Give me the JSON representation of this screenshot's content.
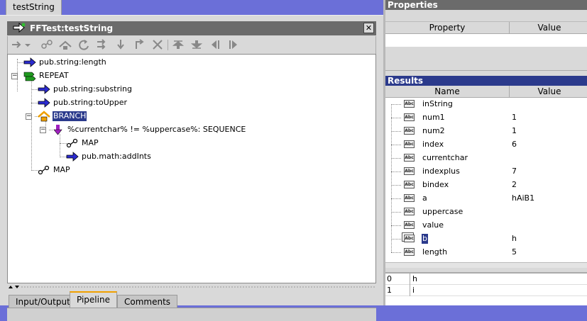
{
  "top_tab": "testString",
  "service": {
    "title": "FFTest:testString",
    "close_label": "✕"
  },
  "toolbar": {
    "icons": [
      "step-into-icon",
      "dropdown-arrow-icon",
      "map-icon",
      "branch-icon",
      "loop-icon",
      "repeat-icon",
      "sequence-icon",
      "exit-icon",
      "disable-icon",
      "move-up-icon",
      "move-down-icon",
      "shift-left-icon",
      "shift-right-icon"
    ]
  },
  "tree": {
    "nodes": [
      {
        "label": "pub.string:length",
        "icon": "invoke-arrow-icon"
      },
      {
        "label": "REPEAT",
        "icon": "repeat-icon"
      },
      {
        "label": "pub.string:substring",
        "icon": "invoke-arrow-icon"
      },
      {
        "label": "pub.string:toUpper",
        "icon": "invoke-arrow-icon"
      },
      {
        "label": "BRANCH",
        "icon": "branch-icon"
      },
      {
        "label": "%currentchar% != %uppercase%: SEQUENCE",
        "icon": "sequence-icon"
      },
      {
        "label": "MAP",
        "icon": "map-icon"
      },
      {
        "label": "pub.math:addInts",
        "icon": "invoke-arrow-icon"
      },
      {
        "label": "MAP",
        "icon": "map-icon"
      }
    ],
    "expander_symbol": "−"
  },
  "bottom_tabs": [
    "Input/Output",
    "Pipeline",
    "Comments"
  ],
  "properties": {
    "title": "Properties",
    "columns": [
      "Property",
      "Value"
    ]
  },
  "results": {
    "title": "Results",
    "columns": [
      "Name",
      "Value"
    ],
    "type_badge": "Abc",
    "rows": [
      {
        "name": "inString",
        "value": ""
      },
      {
        "name": "num1",
        "value": "1"
      },
      {
        "name": "num2",
        "value": "1"
      },
      {
        "name": "index",
        "value": "6"
      },
      {
        "name": "currentchar",
        "value": ""
      },
      {
        "name": "indexplus",
        "value": "7"
      },
      {
        "name": "bindex",
        "value": "2"
      },
      {
        "name": "a",
        "value": "hAiB1"
      },
      {
        "name": "uppercase",
        "value": ""
      },
      {
        "name": "value",
        "value": ""
      },
      {
        "name": "b",
        "value": "h"
      },
      {
        "name": "length",
        "value": "5"
      }
    ]
  },
  "array": {
    "rows": [
      {
        "index": "0",
        "value": "h"
      },
      {
        "index": "1",
        "value": "i"
      }
    ]
  },
  "colors": {
    "background": "#6b6fd8",
    "title_bar": "#6b6b6b",
    "selection": "#2b3a8c",
    "invoke_arrow": "#2b2bd0",
    "repeat_green": "#1f9a1f",
    "branch_orange": "#f0a000",
    "sequence_purple": "#a020c0",
    "active_tab_accent": "#f0a000"
  }
}
